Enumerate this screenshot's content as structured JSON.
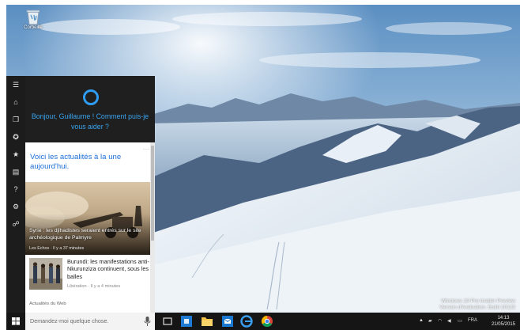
{
  "desktop": {
    "recycle_bin_label": "Corbeille",
    "watermark": [
      "Windows 10 Pro Insider Preview",
      "Version d'évaluation. Build 10122"
    ]
  },
  "cortana": {
    "rail_icons": [
      "hamburger-menu-icon",
      "home-icon",
      "notebook-icon",
      "lightbulb-icon",
      "star-icon",
      "news-icon",
      "help-icon",
      "settings-icon",
      "feedback-icon"
    ],
    "greeting": "Bonjour, Guillaume ! Comment puis-je vous aider ?",
    "card": {
      "title": "Voici les actualités à la une aujourd'hui.",
      "more": "...",
      "main_story": {
        "caption": "Syrie : les djihadistes seraient entrés sur le site archéologique de Palmyre",
        "source": "Les Echos · Il y a 37 minutes"
      },
      "second_story": {
        "title": "Burundi: les manifestations anti-Nkurunziza continuent, sous les balles",
        "source": "Libération · Il y a 4 minutes"
      },
      "section": "Actualités du Web"
    }
  },
  "taskbar": {
    "search_placeholder": "Demandez-moi quelque chose.",
    "apps": [
      "task-view-icon",
      "store-icon",
      "file-explorer-icon",
      "mail-icon",
      "edge-icon",
      "chrome-icon"
    ],
    "tray": {
      "language": "FRA",
      "time": "14:13",
      "date": "21/05/2015"
    }
  },
  "colors": {
    "accent": "#2f9cf2",
    "panel": "#2b2b2b",
    "taskbar": "#151515"
  }
}
